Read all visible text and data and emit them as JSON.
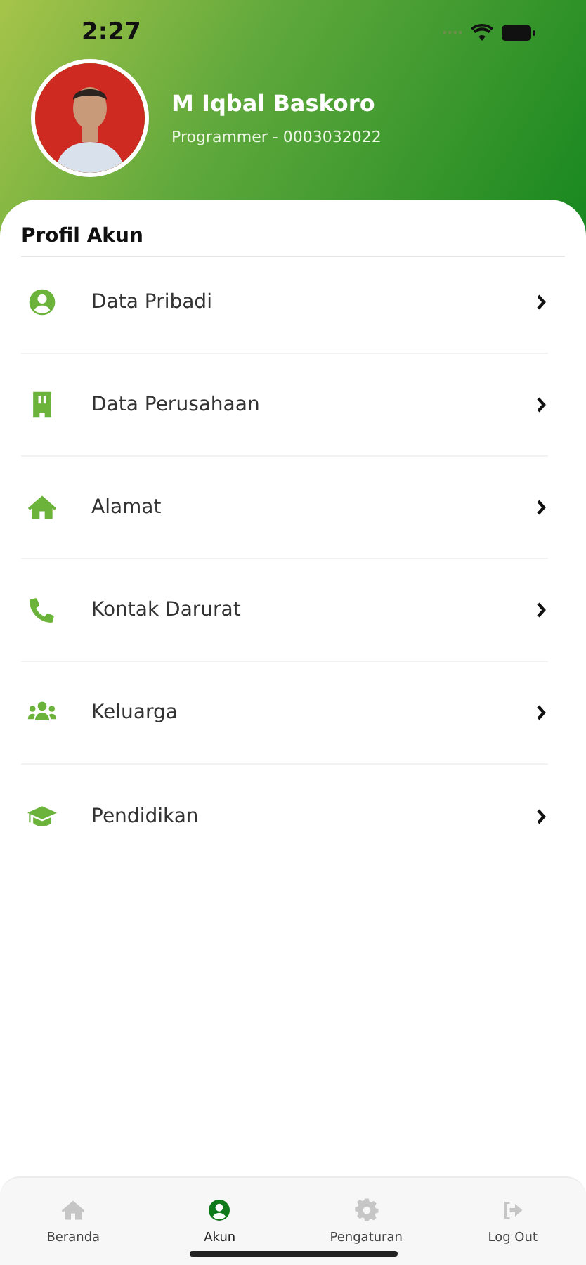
{
  "status_bar": {
    "time": "2:27"
  },
  "profile": {
    "name": "M Iqbal Baskoro",
    "subtitle": "Programmer - 0003032022"
  },
  "section": {
    "title": "Profil Akun"
  },
  "menu": [
    {
      "kind": "person",
      "label": "Data Pribadi"
    },
    {
      "kind": "building",
      "label": "Data Perusahaan"
    },
    {
      "kind": "home",
      "label": "Alamat"
    },
    {
      "kind": "phone",
      "label": "Kontak Darurat"
    },
    {
      "kind": "group",
      "label": "Keluarga"
    },
    {
      "kind": "graduation",
      "label": "Pendidikan"
    }
  ],
  "nav": [
    {
      "kind": "home",
      "label": "Beranda",
      "selected": false
    },
    {
      "kind": "person",
      "label": "Akun",
      "selected": true
    },
    {
      "kind": "gear",
      "label": "Pengaturan",
      "selected": false
    },
    {
      "kind": "logout",
      "label": "Log Out",
      "selected": false
    }
  ]
}
